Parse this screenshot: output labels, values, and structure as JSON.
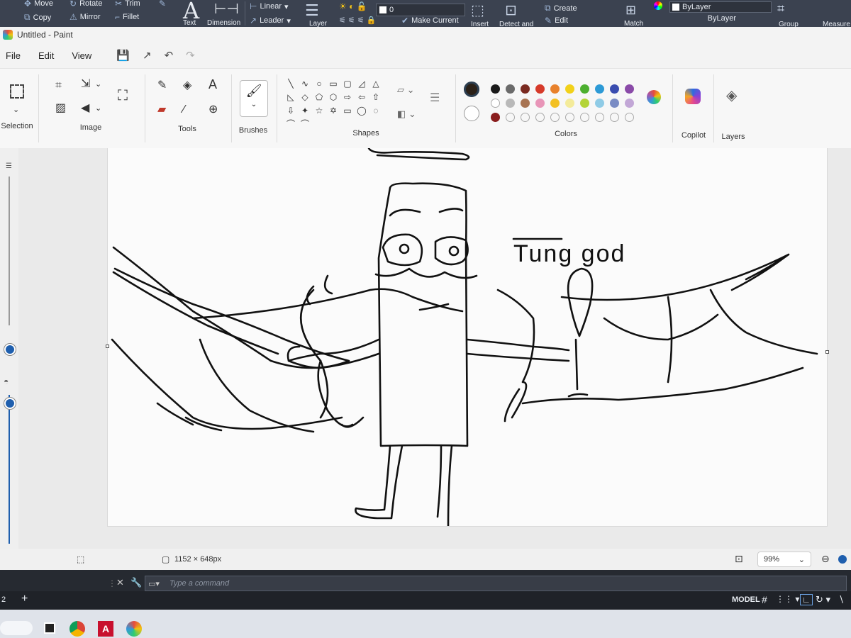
{
  "autocad": {
    "ribbon": {
      "move": "Move",
      "copy": "Copy",
      "rotate": "Rotate",
      "mirror": "Mirror",
      "trim": "Trim",
      "fillet": "Fillet",
      "text": "Text",
      "dimension": "Dimension",
      "linear": "Linear",
      "leader": "Leader",
      "layer": "Layer",
      "layer_value": "0",
      "make_current": "Make Current",
      "insert": "Insert",
      "detect_and": "Detect and",
      "create": "Create",
      "edit": "Edit",
      "match": "Match",
      "bylayer_1": "ByLayer",
      "bylayer_2": "ByLayer",
      "group": "Group",
      "measure": "Measure"
    },
    "command_placeholder": "Type a command",
    "status": {
      "left_num": "2",
      "model": "MODEL"
    }
  },
  "paint": {
    "window_title": "Untitled - Paint",
    "menu": {
      "file": "File",
      "edit": "Edit",
      "view": "View"
    },
    "groups": {
      "selection": "Selection",
      "image": "Image",
      "tools": "Tools",
      "brushes": "Brushes",
      "shapes": "Shapes",
      "colors": "Colors",
      "copilot": "Copilot",
      "layers": "Layers"
    },
    "shapes": [
      "╲",
      "∿",
      "○",
      "▭",
      "▢",
      "◿",
      "△",
      "◺",
      "◇",
      "⬠",
      "⬡",
      "⇨",
      "⇦",
      "⇧",
      "⇩",
      "✦",
      "☆",
      "✡",
      "▭",
      "◯",
      "◌",
      "⌒",
      "⌒"
    ],
    "colors": {
      "primary": "#2b2118",
      "secondary": "#ffffff",
      "row1": [
        "#1a1a1a",
        "#6b6b6b",
        "#7a2a20",
        "#d63a2a",
        "#e8812c",
        "#f2d11a",
        "#4caf2f",
        "#2d9ad6",
        "#3a4db0",
        "#8a4aa8"
      ],
      "row2": [
        "#ffffff",
        "#b9b9b9",
        "#a87452",
        "#e895b8",
        "#f3c022",
        "#f4eb9a",
        "#b4d437",
        "#8fcbe6",
        "#7a8cc4",
        "#c2a7d6"
      ],
      "row3": [
        "#8a1e1e",
        "",
        "",
        "",
        "",
        "",
        "",
        "",
        "",
        ""
      ]
    },
    "drawing_text": "Tung god",
    "status": {
      "canvas_size": "1152 × 648px",
      "zoom": "99%"
    }
  }
}
